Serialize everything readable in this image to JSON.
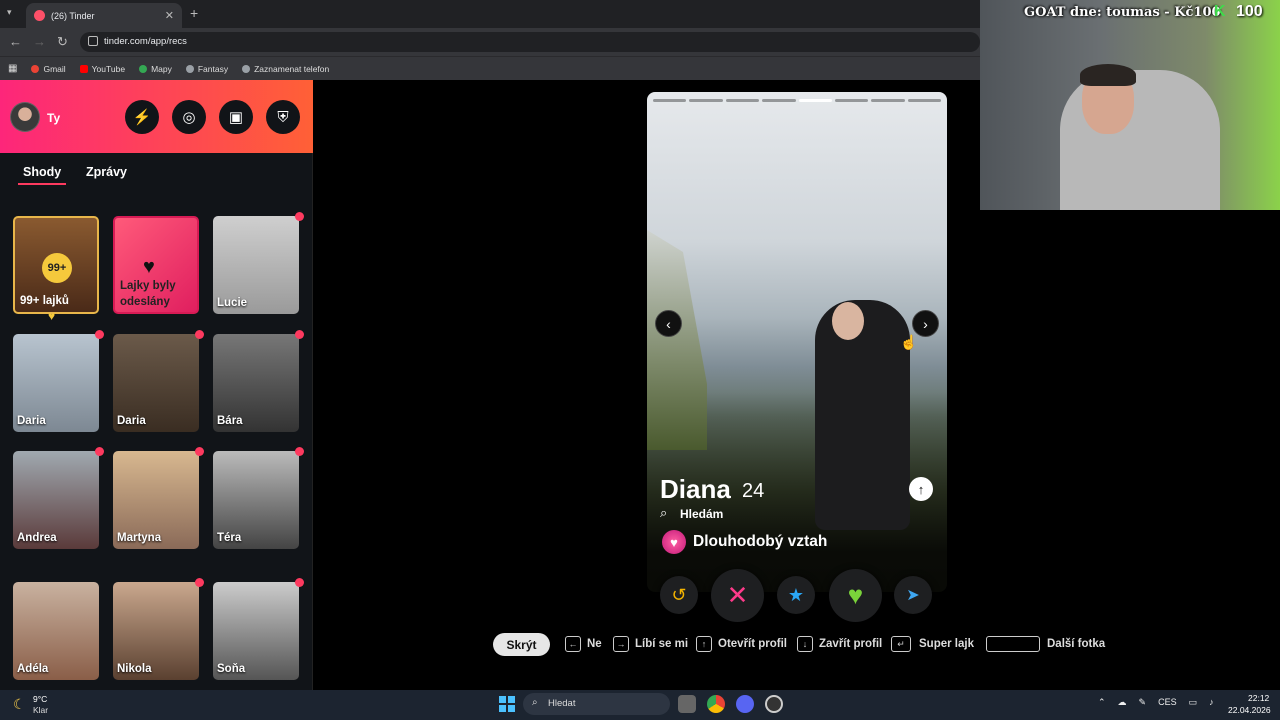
{
  "browser": {
    "tab_title": "(26) Tinder",
    "tab_close": "✕",
    "new_tab": "+",
    "url": "tinder.com/app/recs",
    "bookmarks": [
      "Gmail",
      "YouTube",
      "Mapy",
      "Fantasy",
      "Zaznamenat telefon"
    ]
  },
  "sidebar": {
    "user_label": "Ty",
    "tabs": [
      "Shody",
      "Zprávy"
    ],
    "likes_count": "99+",
    "likes_label": "99+ lajků",
    "sent_label": "Lajky byly odeslány",
    "matches": [
      "Lucie",
      "Daria",
      "Daria",
      "Bára",
      "Andrea",
      "Martyna",
      "Téra",
      "Adéla",
      "Nikola",
      "Soňa"
    ]
  },
  "profile": {
    "name": "Diana",
    "age": "24",
    "looking_label": "Hledám",
    "intent": "Dlouhodobý vztah",
    "photo_count": 8,
    "active_photo": 5
  },
  "shortcuts": {
    "hide": "Skrýt",
    "no": "Ne",
    "like": "Líbí se mi",
    "open_profile": "Otevřít profil",
    "close_profile": "Zavřít profil",
    "super_like": "Super lajk",
    "next_photo": "Další fotka"
  },
  "webcam": {
    "overlay": "GOAT dne: toumas - Kč100",
    "k": "K",
    "count": "100"
  },
  "taskbar": {
    "temp": "9°C",
    "weather": "Klar",
    "search": "Hledat",
    "lang": "CES",
    "time": "22:12",
    "date": "22.04.2026"
  }
}
